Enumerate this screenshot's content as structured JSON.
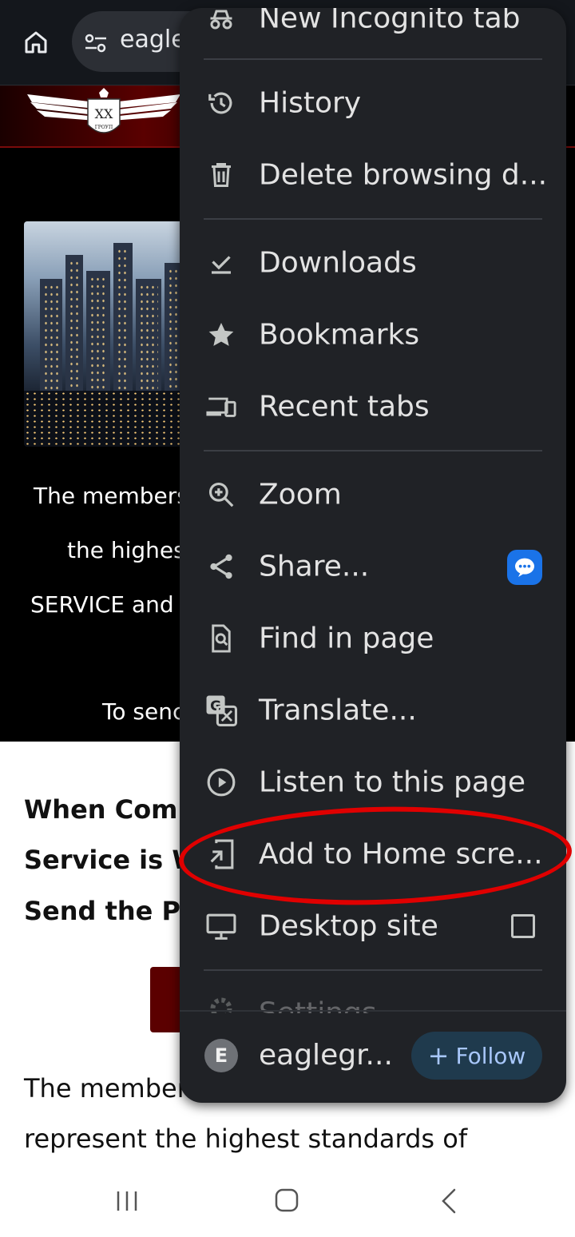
{
  "browser": {
    "url_text": "eagle",
    "icons": {
      "home": "home-icon",
      "site_info": "tune-icon"
    }
  },
  "site": {
    "logo": {
      "name": "eagle-crest-logo",
      "lettering": [
        "XX",
        "ГРОУП"
      ]
    },
    "lines_black": [
      "The members",
      "the highes",
      "SERVICE and",
      "To senc"
    ],
    "lines_white_bold": [
      "When Compl",
      "Service is W",
      "Send the Pro"
    ],
    "lines_white": [
      "The members",
      "represent the highest standards of"
    ]
  },
  "menu": {
    "items": [
      {
        "label": "New Incognito tab",
        "icon": "incognito-icon"
      },
      {
        "label": "History",
        "icon": "history-icon"
      },
      {
        "label": "Delete browsing d...",
        "icon": "trash-icon"
      },
      {
        "label": "Downloads",
        "icon": "download-check-icon"
      },
      {
        "label": "Bookmarks",
        "icon": "star-icon"
      },
      {
        "label": "Recent tabs",
        "icon": "devices-icon"
      },
      {
        "label": "Zoom",
        "icon": "zoom-in-icon"
      },
      {
        "label": "Share...",
        "icon": "share-icon"
      },
      {
        "label": "Find in page",
        "icon": "find-in-page-icon"
      },
      {
        "label": "Translate...",
        "icon": "translate-icon"
      },
      {
        "label": "Listen to this page",
        "icon": "play-circle-icon"
      },
      {
        "label": "Add to Home scre...",
        "icon": "add-to-home-icon"
      },
      {
        "label": "Desktop site",
        "icon": "desktop-icon",
        "checked": false
      },
      {
        "label": "Settings",
        "icon": "gear-icon"
      }
    ],
    "footer": {
      "avatar_letter": "E",
      "site_name": "eaglegr...",
      "follow_label": "Follow",
      "follow_prefix": "+"
    }
  },
  "colors": {
    "menu_bg": "#202226",
    "highlight": "#e00000",
    "follow_text": "#a8c7fa",
    "messages_badge": "#1a73e8"
  },
  "navbar": {
    "icons": [
      "recents-icon",
      "home-nav-icon",
      "back-icon"
    ]
  }
}
